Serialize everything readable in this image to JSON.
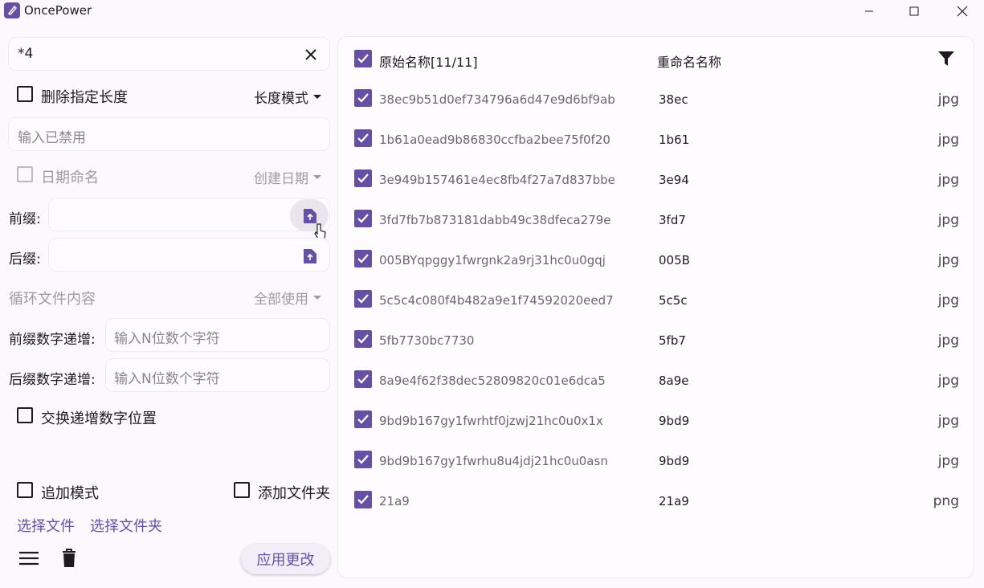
{
  "app": {
    "title": "OncePower"
  },
  "left": {
    "search_value": "*4",
    "delete_length_label": "删除指定长度",
    "length_mode_label": "长度模式",
    "disabled_input_placeholder": "输入已禁用",
    "date_naming_label": "日期命名",
    "create_date_label": "创建日期",
    "prefix_label": "前缀:",
    "suffix_label": "后缀:",
    "loop_file_label": "循环文件内容",
    "use_all_label": "全部使用",
    "prefix_increment_label": "前缀数字递增:",
    "prefix_increment_placeholder": "输入N位数个字符",
    "suffix_increment_label": "后缀数字递增:",
    "suffix_increment_placeholder": "输入N位数个字符",
    "swap_label": "交换递增数字位置",
    "append_mode_label": "追加模式",
    "add_folder_label": "添加文件夹",
    "select_files_label": "选择文件",
    "select_folder_label": "选择文件夹",
    "apply_label": "应用更改"
  },
  "table": {
    "header_original": "原始名称[11/11]",
    "header_renamed": "重命名名称",
    "rows": [
      {
        "original": "38ec9b51d0ef734796a6d47e9d6bf9ab",
        "renamed": "38ec",
        "ext": "jpg"
      },
      {
        "original": "1b61a0ead9b86830ccfba2bee75f0f20",
        "renamed": "1b61",
        "ext": "jpg"
      },
      {
        "original": "3e949b157461e4ec8fb4f27a7d837bbe",
        "renamed": "3e94",
        "ext": "jpg"
      },
      {
        "original": "3fd7fb7b873181dabb49c38dfeca279e",
        "renamed": "3fd7",
        "ext": "jpg"
      },
      {
        "original": "005BYqpggy1fwrgnk2a9rj31hc0u0gqj",
        "renamed": "005B",
        "ext": "jpg"
      },
      {
        "original": "5c5c4c080f4b482a9e1f74592020eed7",
        "renamed": "5c5c",
        "ext": "jpg"
      },
      {
        "original": "5fb7730bc7730",
        "renamed": "5fb7",
        "ext": "jpg"
      },
      {
        "original": "8a9e4f62f38dec52809820c01e6dca5",
        "renamed": "8a9e",
        "ext": "jpg"
      },
      {
        "original": "9bd9b167gy1fwrhtf0jzwj21hc0u0x1x",
        "renamed": "9bd9",
        "ext": "jpg"
      },
      {
        "original": "9bd9b167gy1fwrhu8u4jdj21hc0u0asn",
        "renamed": "9bd9",
        "ext": "jpg"
      },
      {
        "original": "21a9",
        "renamed": "21a9",
        "ext": "png"
      }
    ]
  },
  "colors": {
    "accent": "#6750a4",
    "background": "#fcf8fe"
  }
}
